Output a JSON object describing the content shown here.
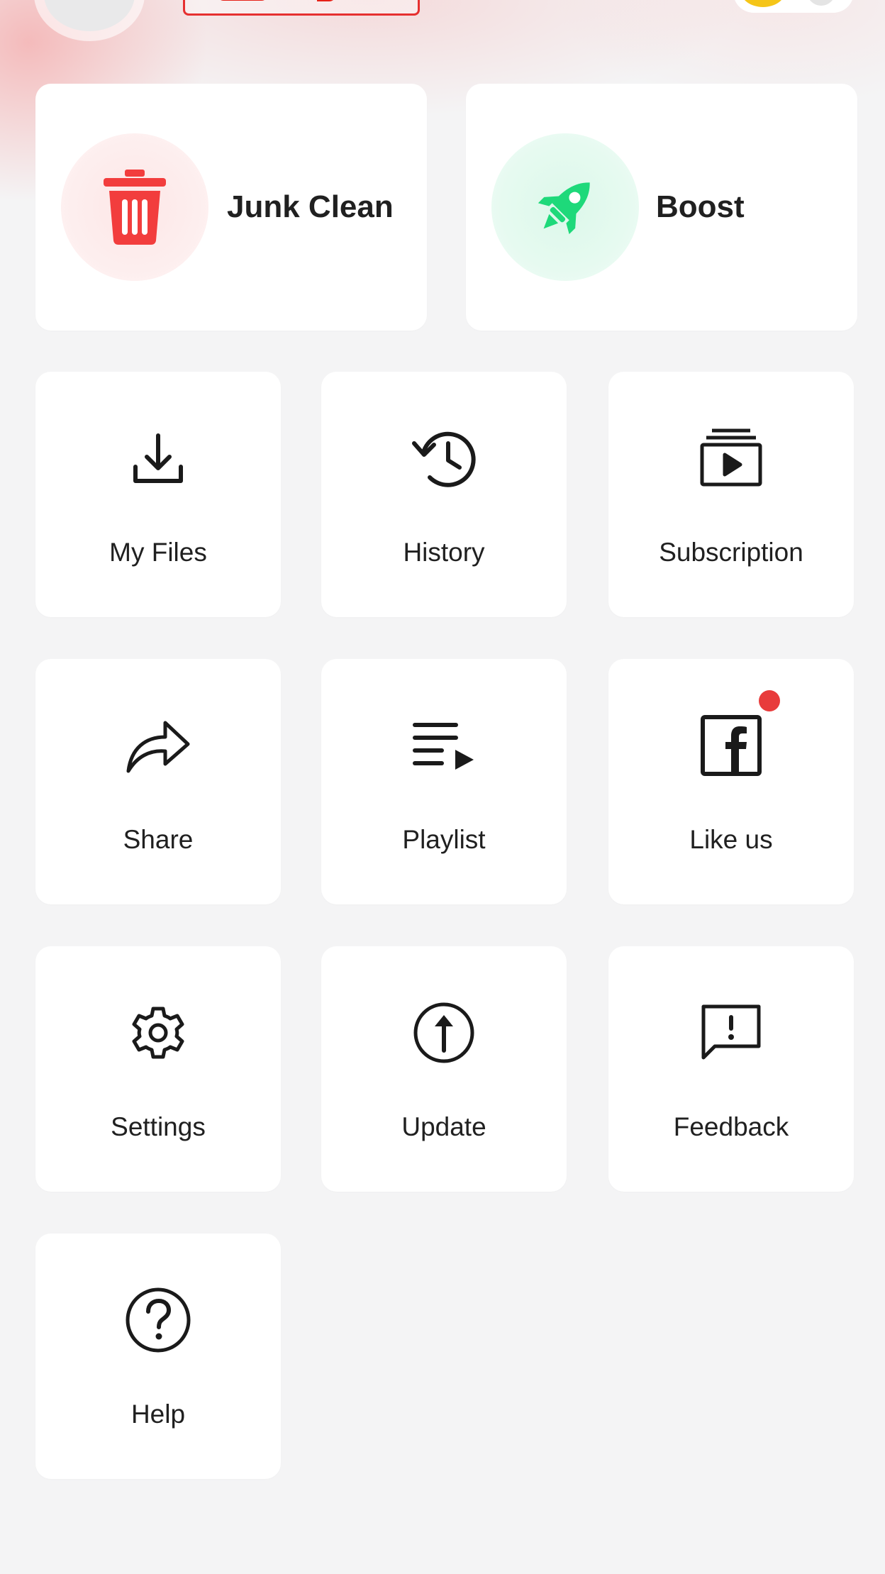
{
  "quick_actions": {
    "junk_clean": {
      "label": "Junk Clean",
      "icon": "trash-icon",
      "color": "#f23d3d"
    },
    "boost": {
      "label": "Boost",
      "icon": "rocket-icon",
      "color": "#1ed97a"
    }
  },
  "menu": {
    "items": [
      {
        "label": "My Files",
        "icon": "download-icon"
      },
      {
        "label": "History",
        "icon": "history-icon"
      },
      {
        "label": "Subscription",
        "icon": "subscription-icon"
      },
      {
        "label": "Share",
        "icon": "share-icon"
      },
      {
        "label": "Playlist",
        "icon": "playlist-icon"
      },
      {
        "label": "Like us",
        "icon": "facebook-icon",
        "has_badge": true
      },
      {
        "label": "Settings",
        "icon": "gear-icon"
      },
      {
        "label": "Update",
        "icon": "update-icon"
      },
      {
        "label": "Feedback",
        "icon": "feedback-icon"
      },
      {
        "label": "Help",
        "icon": "help-icon"
      }
    ]
  },
  "colors": {
    "accent_red": "#e62117",
    "badge": "#e83b3b",
    "background": "#f4f4f5"
  }
}
